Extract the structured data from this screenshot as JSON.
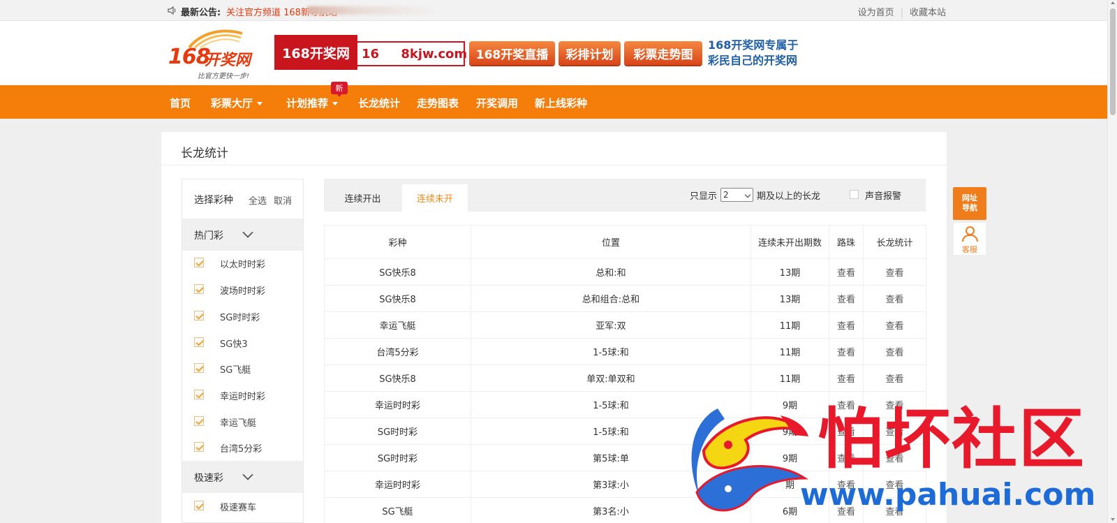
{
  "topbar": {
    "notice_label": "最新公告:",
    "notice_text": "关注官方频道 168新导航站",
    "set_home": "设为首页",
    "bookmark": "收藏本站"
  },
  "header": {
    "logo_num": "168",
    "logo_name": "开奖网",
    "logo_slogan": "比官方更快一步!",
    "banner_name": "168开奖网",
    "banner_url": "16     8kjw.com",
    "btn_live": "168开奖直播",
    "btn_plan": "彩排计划",
    "btn_trend": "彩票走势图",
    "tagline_1": "168开奖网专属于",
    "tagline_2": "彩民自己的开奖网"
  },
  "nav": {
    "home": "首页",
    "lottery_hall": "彩票大厅",
    "plan": "计划推荐",
    "new_badge": "新",
    "longdragon": "长龙统计",
    "trend": "走势图表",
    "api": "开奖调用",
    "new_games": "新上线彩种"
  },
  "page": {
    "title": "长龙统计"
  },
  "side": {
    "select_label": "选择彩种",
    "select_all": "全选",
    "cancel": "取消",
    "group_hot": "热门彩",
    "hot_items": [
      "以太时时彩",
      "波场时时彩",
      "SG时时彩",
      "SG快3",
      "SG飞艇",
      "幸运时时彩",
      "幸运飞艇",
      "台湾5分彩"
    ],
    "group_fast": "极速彩",
    "fast_items": [
      "极速赛车"
    ]
  },
  "toolbar": {
    "tab_consecutive_open": "连续开出",
    "tab_consecutive_not_open": "连续未开",
    "filter_prefix": "只显示",
    "filter_value": "2",
    "filter_suffix": "期及以上的长龙",
    "sound_alarm": "声音报警"
  },
  "table": {
    "headers": [
      "彩种",
      "位置",
      "连续未开出期数",
      "路珠",
      "长龙统计"
    ],
    "rows": [
      {
        "game": "SG快乐8",
        "position": "总和:和",
        "count": "13期",
        "road": "查看",
        "stat": "查看"
      },
      {
        "game": "SG快乐8",
        "position": "总和组合:总和",
        "count": "13期",
        "road": "查看",
        "stat": "查看"
      },
      {
        "game": "幸运飞艇",
        "position": "亚军:双",
        "count": "11期",
        "road": "查看",
        "stat": "查看"
      },
      {
        "game": "台湾5分彩",
        "position": "1-5球:和",
        "count": "11期",
        "road": "查看",
        "stat": "查看"
      },
      {
        "game": "SG快乐8",
        "position": "单双:单双和",
        "count": "11期",
        "road": "查看",
        "stat": "查看"
      },
      {
        "game": "幸运时时彩",
        "position": "1-5球:和",
        "count": "9期",
        "road": "查看",
        "stat": "查看"
      },
      {
        "game": "SG时时彩",
        "position": "1-5球:和",
        "count": "9期",
        "road": "查看",
        "stat": "查看"
      },
      {
        "game": "SG时时彩",
        "position": "第5球:单",
        "count": "9期",
        "road": "查看",
        "stat": "查看"
      },
      {
        "game": "幸运时时彩",
        "position": "第3球:小",
        "count": "期",
        "road": "查看",
        "stat": "查看"
      },
      {
        "game": "SG飞艇",
        "position": "第3名:小",
        "count": "6期",
        "road": "查看",
        "stat": "查看"
      }
    ]
  },
  "float": {
    "nav_label_1": "网址",
    "nav_label_2": "导航",
    "service": "客服"
  },
  "watermark": {
    "text": "怕坏社区",
    "url": "www.pahuai.com"
  }
}
